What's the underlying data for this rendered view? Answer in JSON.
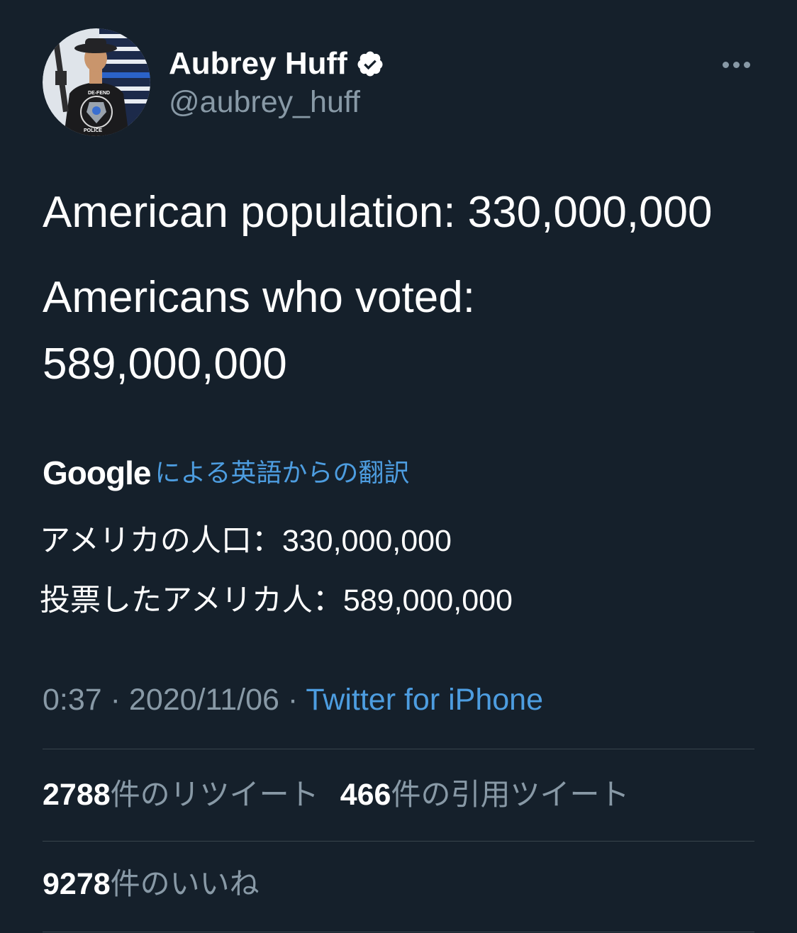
{
  "author": {
    "display_name": "Aubrey Huff",
    "handle": "@aubrey_huff",
    "avatar_badge_top": "DE-FEND",
    "avatar_badge_bottom": "POLICE"
  },
  "tweet": {
    "line1": "American population: 330,000,000",
    "line2": "Americans who voted:",
    "line3": "589,000,000"
  },
  "translation": {
    "provider": "Google",
    "label": "による英語からの翻訳",
    "line1": "アメリカの人口：330,000,000",
    "line2": "投票したアメリカ人：589,000,000"
  },
  "meta": {
    "time": "0:37",
    "separator": " · ",
    "date": "2020/11/06",
    "source": "Twitter for iPhone"
  },
  "stats": {
    "retweets_count": "2788",
    "retweets_label": "件のリツイート",
    "quotes_count": "466",
    "quotes_label": "件の引用ツイート",
    "likes_count": "9278",
    "likes_label": "件のいいね"
  },
  "colors": {
    "background": "#15202b",
    "secondary_text": "#8899a6",
    "link": "#4d9de0",
    "divider": "#38444d"
  },
  "icons": {
    "verified": "verified-badge-icon",
    "more": "more-horizontal-icon"
  }
}
